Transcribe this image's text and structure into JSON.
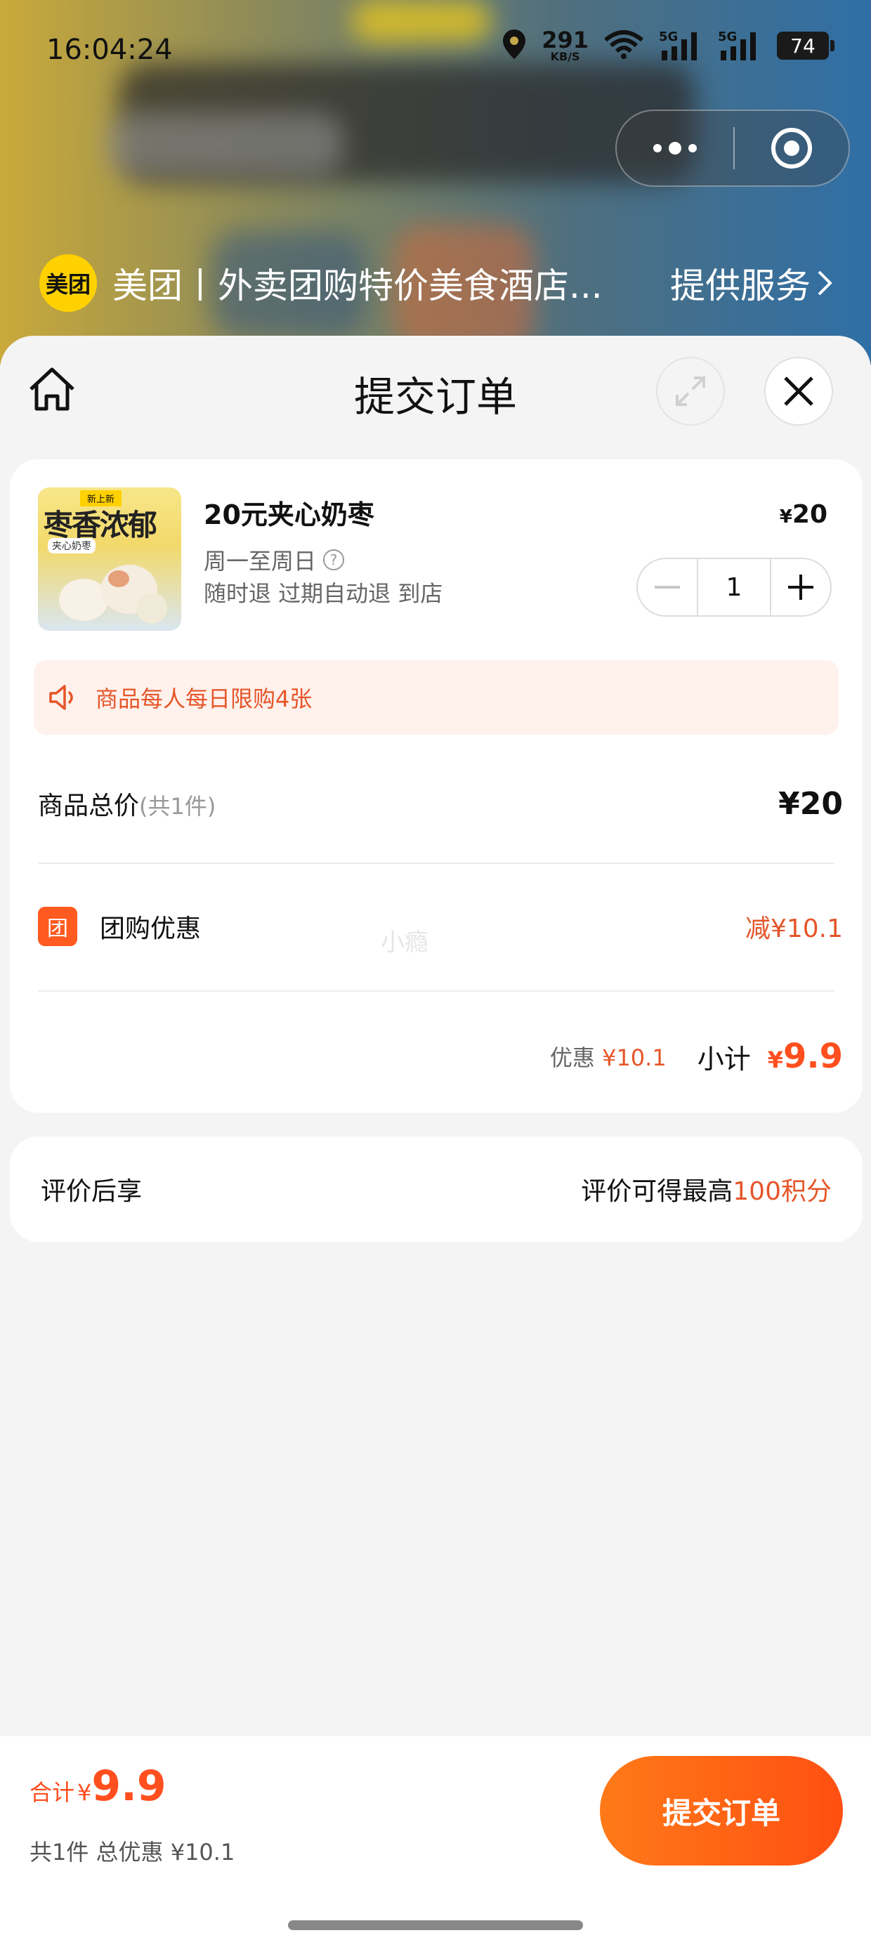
{
  "status_bar": {
    "time": "16:04:24",
    "net_speed": "291",
    "net_unit": "KB/S",
    "signal1_label": "5G",
    "signal2_label": "5G",
    "battery": "74"
  },
  "provider": {
    "logo_text": "美团",
    "name": "美团丨外卖团购特价美食酒店...",
    "service_label": "提供服务"
  },
  "header": {
    "title": "提交订单"
  },
  "product": {
    "thumb_tag": "新上新",
    "thumb_title": "枣香浓郁",
    "thumb_sub": "夹心奶枣",
    "name": "20元夹心奶枣",
    "days": "周一至周日",
    "rules": "随时退 过期自动退 到店",
    "price_symbol": "¥",
    "price": "20",
    "quantity": "1"
  },
  "notice": {
    "text": "商品每人每日限购4张"
  },
  "summary": {
    "total_label": "商品总价",
    "total_count": "(共1件)",
    "total_value": "¥20",
    "discount_icon_text": "团",
    "discount_label": "团购优惠",
    "discount_value": "减¥10.1",
    "watermark": "小瘾",
    "saved_label": "优惠",
    "saved_value": "¥10.1",
    "subtotal_label": "小计",
    "subtotal_symbol": "¥",
    "subtotal_value": "9.9"
  },
  "review": {
    "label": "评价后享",
    "text_prefix": "评价可得最高",
    "text_highlight": "100积分"
  },
  "bottom_bar": {
    "sum_label": "合计",
    "sum_symbol": "¥",
    "sum_value": "9.9",
    "sub_text": "共1件 总优惠 ¥10.1",
    "submit_label": "提交订单"
  },
  "colors": {
    "accent": "#ff4f1f",
    "discount_text": "#e5562a",
    "notice_bg": "#fff1ec",
    "brand_yellow": "#ffd100"
  }
}
